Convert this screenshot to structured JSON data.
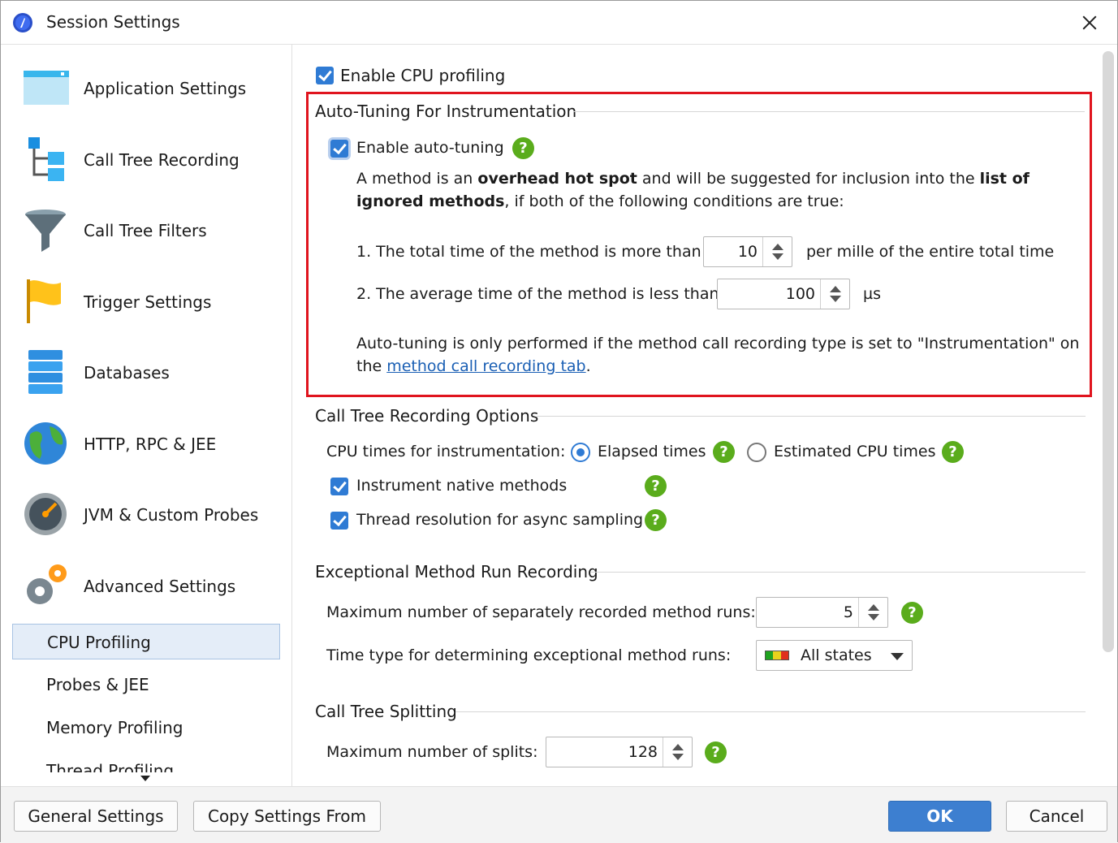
{
  "window": {
    "title": "Session Settings"
  },
  "sidebar": {
    "items": [
      {
        "label": "Application Settings",
        "icon": "application-window-icon"
      },
      {
        "label": "Call Tree Recording",
        "icon": "call-tree-icon"
      },
      {
        "label": "Call Tree Filters",
        "icon": "filter-funnel-icon"
      },
      {
        "label": "Trigger Settings",
        "icon": "flag-icon"
      },
      {
        "label": "Databases",
        "icon": "database-icon"
      },
      {
        "label": "HTTP, RPC & JEE",
        "icon": "globe-icon"
      },
      {
        "label": "JVM & Custom Probes",
        "icon": "gauge-icon"
      },
      {
        "label": "Advanced Settings",
        "icon": "gears-icon"
      }
    ],
    "subitems": [
      {
        "label": "CPU Profiling",
        "selected": true
      },
      {
        "label": "Probes & JEE"
      },
      {
        "label": "Memory Profiling"
      },
      {
        "label": "Thread Profiling"
      }
    ]
  },
  "cpu": {
    "enable_label": "Enable CPU profiling",
    "autotune": {
      "title": "Auto-Tuning For Instrumentation",
      "enable_label": "Enable auto-tuning",
      "desc_p1": "A method is an ",
      "desc_b1": "overhead hot spot",
      "desc_p2": " and will be suggested for inclusion into the ",
      "desc_b2": "list of",
      "desc_b3": "ignored methods",
      "desc_p3": ", if both of the following conditions are true:",
      "cond1_label": "1. The total time of the method is more than",
      "cond1_value": "10",
      "cond1_suffix": "per mille of the entire total time",
      "cond2_label": "2. The average time of the method is less than",
      "cond2_value": "100",
      "cond2_suffix": "µs",
      "note_line1": "Auto-tuning is only performed if the method call recording type is set to \"Instrumentation\" on",
      "note_prefix": "the ",
      "note_link": "method call recording tab",
      "note_suffix": "."
    },
    "recording": {
      "title": "Call Tree Recording Options",
      "cpu_times_label": "CPU times for instrumentation:",
      "elapsed_label": "Elapsed times",
      "estimated_label": "Estimated CPU times",
      "native_label": "Instrument native methods",
      "thread_label": "Thread resolution for async sampling"
    },
    "exceptional": {
      "title": "Exceptional Method Run Recording",
      "max_runs_label": "Maximum number of separately recorded method runs:",
      "max_runs_value": "5",
      "time_type_label": "Time type for determining exceptional method runs:",
      "time_type_value": "All states"
    },
    "splitting": {
      "title": "Call Tree Splitting",
      "max_splits_label": "Maximum number of splits:",
      "max_splits_value": "128"
    }
  },
  "footer": {
    "general_settings": "General Settings",
    "copy_settings": "Copy Settings From",
    "ok": "OK",
    "cancel": "Cancel"
  },
  "help_glyph": "?",
  "colors": {
    "accent": "#2f7bd4",
    "highlight": "#e0141e",
    "help": "#5aac1c",
    "link": "#1a5fb4"
  }
}
